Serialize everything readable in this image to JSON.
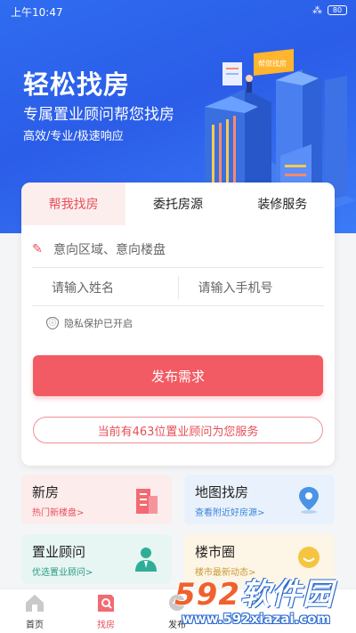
{
  "status_bar": {
    "time": "上午10:47",
    "signal": "⁂",
    "battery": "80"
  },
  "hero": {
    "title": "轻松找房",
    "subtitle": "专属置业顾问帮您找房",
    "tagline": "高效/专业/极速响应",
    "sign_text": "帮您找房"
  },
  "tabs": [
    {
      "label": "帮我找房",
      "active": true
    },
    {
      "label": "委托房源",
      "active": false
    },
    {
      "label": "装修服务",
      "active": false
    }
  ],
  "form": {
    "area_placeholder": "意向区域、意向楼盘",
    "name_placeholder": "请输入姓名",
    "phone_placeholder": "请输入手机号",
    "privacy_text": "隐私保护已开启",
    "submit_label": "发布需求",
    "advisor_notice": "当前有463位置业顾问为您服务"
  },
  "features": [
    {
      "title": "新房",
      "subtitle": "热门新楼盘>",
      "icon": "building-icon"
    },
    {
      "title": "地图找房",
      "subtitle": "查看附近好房源>",
      "icon": "map-pin-icon"
    },
    {
      "title": "置业顾问",
      "subtitle": "优选置业顾问>",
      "icon": "advisor-icon"
    },
    {
      "title": "楼市圈",
      "subtitle": "楼市最新动态>",
      "icon": "chat-bubble-icon"
    }
  ],
  "bottom_nav": [
    {
      "label": "首页",
      "icon": "home-icon",
      "active": false
    },
    {
      "label": "找房",
      "icon": "search-house-icon",
      "active": true
    },
    {
      "label": "发布",
      "icon": "publish-icon",
      "active": false
    }
  ],
  "watermark": {
    "logo_number": "592",
    "logo_text": "软件园",
    "url": "www.592xiazai.com"
  },
  "colors": {
    "accent": "#f25b63",
    "hero_blue": "#2f6cf0",
    "map_blue": "#3b83d8",
    "advisor_green": "#2a9a86"
  }
}
